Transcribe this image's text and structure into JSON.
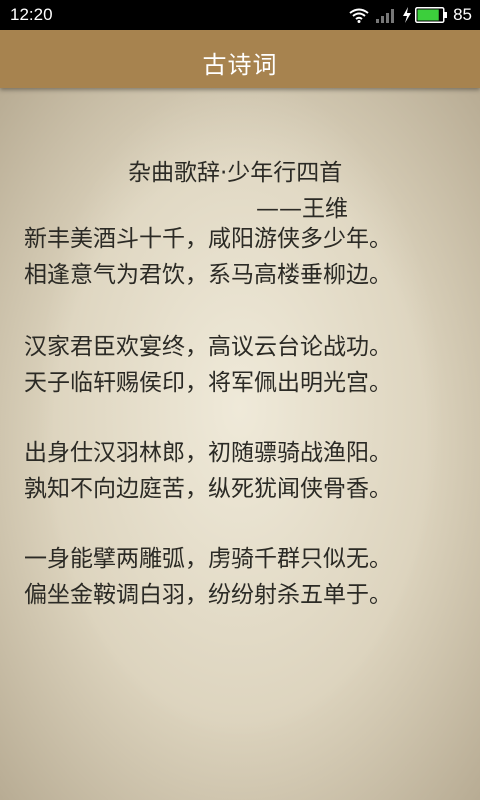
{
  "status_bar": {
    "time": "12:20",
    "battery_percent": "85",
    "battery_level": 0.85,
    "icons": [
      "wifi-icon",
      "signal-icon",
      "charging-icon",
      "battery-icon"
    ]
  },
  "app_bar": {
    "title": "古诗词",
    "color": "#a7834f"
  },
  "poem": {
    "title": "杂曲歌辞·少年行四首",
    "author": "——王维",
    "stanzas": [
      [
        "新丰美酒斗十千，咸阳游侠多少年。",
        "相逢意气为君饮，系马高楼垂柳边。"
      ],
      [
        "汉家君臣欢宴终，高议云台论战功。",
        "天子临轩赐侯印，将军佩出明光宫。"
      ],
      [
        "出身仕汉羽林郎，初随骠骑战渔阳。",
        "孰知不向边庭苦，纵死犹闻侠骨香。"
      ],
      [
        "一身能擘两雕弧，虏骑千群只似无。",
        "偏坐金鞍调白羽，纷纷射杀五单于。"
      ]
    ]
  },
  "colors": {
    "paper": "#dcd3bd",
    "text": "#2b2a25"
  }
}
